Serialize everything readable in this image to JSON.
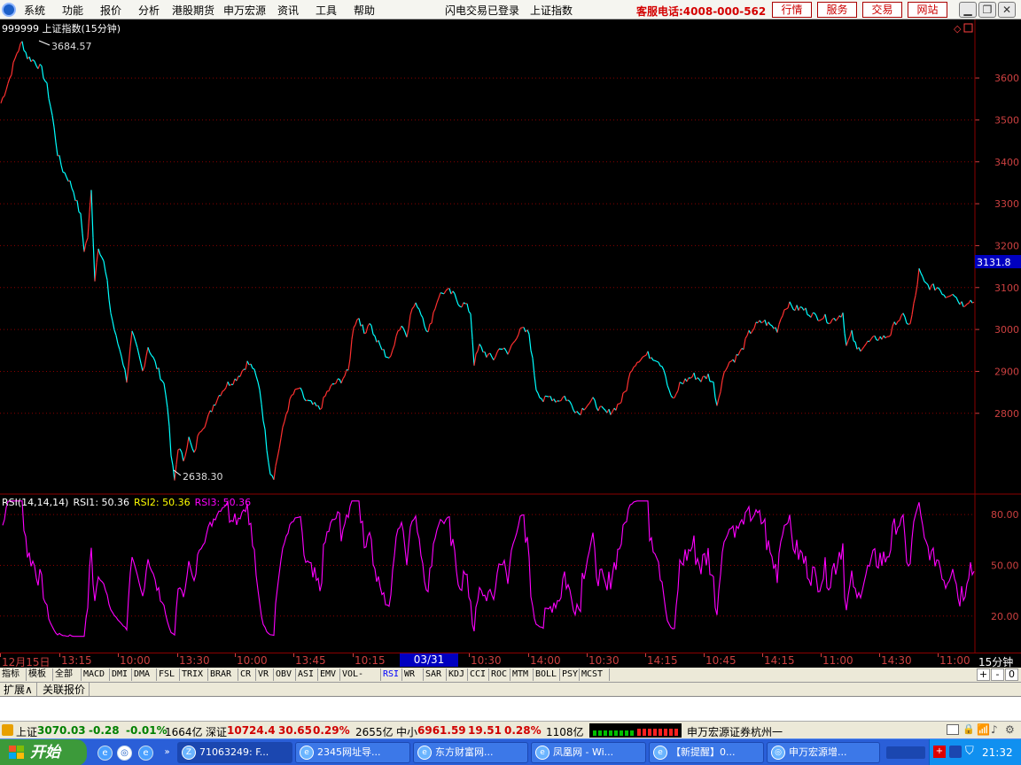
{
  "menubar": {
    "items": [
      "系统",
      "功能",
      "报价",
      "分析",
      "港股期货",
      "申万宏源",
      "资讯",
      "工具",
      "帮助"
    ],
    "login_status": "闪电交易已登录",
    "current_index": "上证指数",
    "hotline": "客服电话:4008-000-562",
    "buttons": [
      "行情",
      "服务",
      "交易",
      "网站"
    ]
  },
  "chart_data": {
    "type": "line",
    "title": "999999 上证指数(15分钟)",
    "main_yticks": [
      3600,
      3500,
      3400,
      3300,
      3200,
      3100,
      3000,
      2900,
      2800
    ],
    "ylim": [
      2620,
      3710
    ],
    "high_label": "3684.57",
    "low_label": "2638.30",
    "current_price": "3131.8",
    "price_anchors": [
      [
        0,
        3540
      ],
      [
        10,
        3600
      ],
      [
        18,
        3660
      ],
      [
        24,
        3684.57
      ],
      [
        30,
        3650
      ],
      [
        38,
        3640
      ],
      [
        46,
        3620
      ],
      [
        52,
        3580
      ],
      [
        58,
        3510
      ],
      [
        64,
        3420
      ],
      [
        70,
        3380
      ],
      [
        76,
        3360
      ],
      [
        82,
        3330
      ],
      [
        86,
        3300
      ],
      [
        90,
        3270
      ],
      [
        94,
        3190
      ],
      [
        98,
        3220
      ],
      [
        102,
        3330
      ],
      [
        106,
        3120
      ],
      [
        110,
        3200
      ],
      [
        116,
        3160
      ],
      [
        120,
        3110
      ],
      [
        124,
        3040
      ],
      [
        130,
        2980
      ],
      [
        136,
        2940
      ],
      [
        142,
        2880
      ],
      [
        148,
        2990
      ],
      [
        154,
        2950
      ],
      [
        160,
        2900
      ],
      [
        166,
        2960
      ],
      [
        172,
        2930
      ],
      [
        178,
        2900
      ],
      [
        184,
        2870
      ],
      [
        188,
        2820
      ],
      [
        192,
        2700
      ],
      [
        196,
        2638.3
      ],
      [
        200,
        2720
      ],
      [
        206,
        2690
      ],
      [
        212,
        2740
      ],
      [
        218,
        2700
      ],
      [
        224,
        2760
      ],
      [
        232,
        2780
      ],
      [
        240,
        2820
      ],
      [
        248,
        2850
      ],
      [
        256,
        2870
      ],
      [
        264,
        2880
      ],
      [
        272,
        2900
      ],
      [
        278,
        2920
      ],
      [
        284,
        2910
      ],
      [
        292,
        2860
      ],
      [
        296,
        2790
      ],
      [
        300,
        2720
      ],
      [
        304,
        2660
      ],
      [
        308,
        2650
      ],
      [
        316,
        2740
      ],
      [
        322,
        2800
      ],
      [
        328,
        2840
      ],
      [
        336,
        2860
      ],
      [
        344,
        2830
      ],
      [
        352,
        2820
      ],
      [
        360,
        2810
      ],
      [
        368,
        2850
      ],
      [
        376,
        2870
      ],
      [
        384,
        2880
      ],
      [
        392,
        2900
      ],
      [
        398,
        3010
      ],
      [
        404,
        3030
      ],
      [
        410,
        2990
      ],
      [
        416,
        3020
      ],
      [
        422,
        2980
      ],
      [
        428,
        2960
      ],
      [
        434,
        2940
      ],
      [
        440,
        2930
      ],
      [
        446,
        2990
      ],
      [
        452,
        3010
      ],
      [
        458,
        2990
      ],
      [
        464,
        3050
      ],
      [
        470,
        3060
      ],
      [
        476,
        3030
      ],
      [
        482,
        2990
      ],
      [
        488,
        3040
      ],
      [
        494,
        3080
      ],
      [
        500,
        3090
      ],
      [
        506,
        3090
      ],
      [
        512,
        3080
      ],
      [
        518,
        3060
      ],
      [
        524,
        3060
      ],
      [
        530,
        3040
      ],
      [
        534,
        2920
      ],
      [
        540,
        2960
      ],
      [
        548,
        2940
      ],
      [
        556,
        2930
      ],
      [
        564,
        2960
      ],
      [
        572,
        2940
      ],
      [
        580,
        2980
      ],
      [
        588,
        3000
      ],
      [
        596,
        2990
      ],
      [
        604,
        2860
      ],
      [
        612,
        2830
      ],
      [
        620,
        2840
      ],
      [
        628,
        2830
      ],
      [
        636,
        2840
      ],
      [
        644,
        2820
      ],
      [
        652,
        2800
      ],
      [
        660,
        2820
      ],
      [
        668,
        2830
      ],
      [
        676,
        2810
      ],
      [
        684,
        2800
      ],
      [
        692,
        2810
      ],
      [
        700,
        2830
      ],
      [
        706,
        2860
      ],
      [
        712,
        2910
      ],
      [
        720,
        2930
      ],
      [
        730,
        2940
      ],
      [
        740,
        2930
      ],
      [
        748,
        2910
      ],
      [
        754,
        2850
      ],
      [
        760,
        2830
      ],
      [
        766,
        2870
      ],
      [
        774,
        2880
      ],
      [
        782,
        2890
      ],
      [
        790,
        2880
      ],
      [
        798,
        2890
      ],
      [
        804,
        2870
      ],
      [
        808,
        2820
      ],
      [
        814,
        2880
      ],
      [
        820,
        2920
      ],
      [
        828,
        2930
      ],
      [
        836,
        2950
      ],
      [
        844,
        2990
      ],
      [
        852,
        3010
      ],
      [
        860,
        3020
      ],
      [
        868,
        3010
      ],
      [
        876,
        3000
      ],
      [
        882,
        3040
      ],
      [
        888,
        3060
      ],
      [
        896,
        3050
      ],
      [
        904,
        3050
      ],
      [
        912,
        3040
      ],
      [
        920,
        3030
      ],
      [
        928,
        3030
      ],
      [
        936,
        3020
      ],
      [
        944,
        3030
      ],
      [
        950,
        3040
      ],
      [
        954,
        2960
      ],
      [
        960,
        2990
      ],
      [
        966,
        2950
      ],
      [
        972,
        2960
      ],
      [
        980,
        2970
      ],
      [
        988,
        2980
      ],
      [
        996,
        2980
      ],
      [
        1004,
        2990
      ],
      [
        1010,
        3020
      ],
      [
        1018,
        3030
      ],
      [
        1026,
        3010
      ],
      [
        1032,
        3080
      ],
      [
        1036,
        3140
      ],
      [
        1042,
        3110
      ],
      [
        1050,
        3100
      ],
      [
        1058,
        3100
      ],
      [
        1066,
        3080
      ],
      [
        1074,
        3090
      ],
      [
        1080,
        3070
      ],
      [
        1086,
        3060
      ],
      [
        1092,
        3070
      ],
      [
        1098,
        3065
      ]
    ],
    "rsi": {
      "label": "RSI(14,14,14)",
      "series": [
        {
          "name": "RSI1",
          "value": "50.36",
          "color": "#ffffff"
        },
        {
          "name": "RSI2",
          "value": "50.36",
          "color": "#ffff00"
        },
        {
          "name": "RSI3",
          "value": "50.36",
          "color": "#ff00ff"
        }
      ],
      "yticks": [
        80,
        50,
        20
      ],
      "ylim": [
        0,
        90
      ],
      "line_color": "#ff00ff"
    }
  },
  "xaxis": {
    "ticks": [
      {
        "label": "12月15日",
        "x": 0
      },
      {
        "label": "13:15",
        "x": 67
      },
      {
        "label": "10:00",
        "x": 133
      },
      {
        "label": "13:30",
        "x": 200
      },
      {
        "label": "10:00",
        "x": 265
      },
      {
        "label": "13:45",
        "x": 331
      },
      {
        "label": "10:15",
        "x": 398
      },
      {
        "label": "10:30",
        "x": 529
      },
      {
        "label": "14:00",
        "x": 596
      },
      {
        "label": "10:30",
        "x": 662
      },
      {
        "label": "14:15",
        "x": 728
      },
      {
        "label": "10:45",
        "x": 794
      },
      {
        "label": "14:15",
        "x": 860
      },
      {
        "label": "11:00",
        "x": 926
      },
      {
        "label": "14:30",
        "x": 992
      },
      {
        "label": "11:00",
        "x": 1058
      }
    ],
    "selected": "03/31 13:30",
    "period": "15分钟"
  },
  "indicator_tabs": [
    "指标",
    "模板",
    "全部",
    "MACD",
    "DMI",
    "DMA",
    "FSL",
    "TRIX",
    "BRAR",
    "CR",
    "VR",
    "OBV",
    "ASI",
    "EMV",
    "VOL-TDX",
    "RSI",
    "WR",
    "SAR",
    "KDJ",
    "CCI",
    "ROC",
    "MTM",
    "BOLL",
    "PSY",
    "MCST"
  ],
  "zoom_buttons": [
    "+",
    "-",
    "0"
  ],
  "sub_tabs": [
    "扩展∧",
    "关联报价"
  ],
  "status": {
    "sh_label": "上证",
    "sh_value": "3070.03",
    "sh_change": "-0.28",
    "sh_pct": "-0.01%",
    "sh_amount": "1664亿",
    "sz_label": "深证",
    "sz_value": "10724.4",
    "sz_change": "30.65",
    "sz_pct": "0.29%",
    "sz_amount": "2655亿",
    "zx_label": "中小",
    "zx_value": "6961.59",
    "zx_change": "19.51",
    "zx_pct": "0.28%",
    "zx_amount": "1108亿",
    "broker": "申万宏源证券杭州一"
  },
  "taskbar": {
    "start": "开始",
    "tasks": [
      "71063249: F...",
      "2345网址导...",
      "东方财富网...",
      "凤凰网 - Wi...",
      "【新提醒】0...",
      "申万宏源增..."
    ],
    "clock": "21:32"
  },
  "colors": {
    "up": "#ff3030",
    "down": "#00ffff",
    "grid": "#8b0000",
    "axis_text": "#cc4040"
  }
}
